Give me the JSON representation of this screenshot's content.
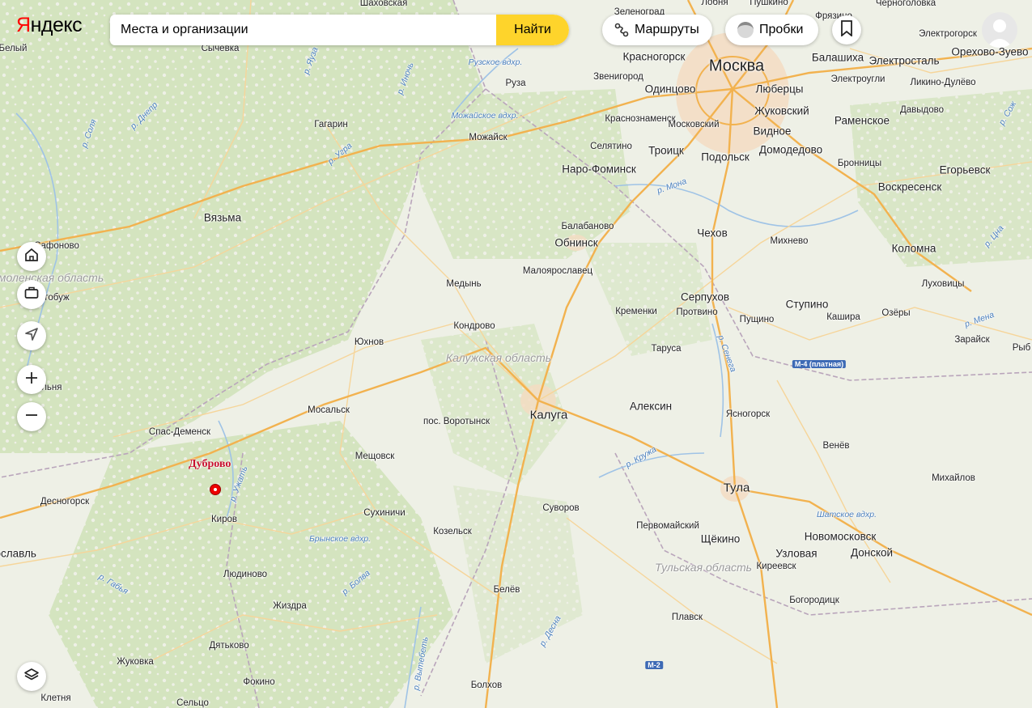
{
  "header": {
    "logo_first": "Я",
    "logo_rest": "ндекс",
    "search_placeholder": "Места и организации",
    "search_button": "Найти",
    "routes_label": "Маршруты",
    "traffic_label": "Пробки"
  },
  "marker": {
    "label": "Дуброво"
  },
  "map_labels": [
    {
      "text": "Москва",
      "kind": "cap"
    },
    {
      "text": "Калуга",
      "kind": "big"
    },
    {
      "text": "Тула",
      "kind": "big"
    },
    {
      "text": "Вязьма",
      "kind": "mid"
    },
    {
      "text": "Обнинск",
      "kind": "mid"
    },
    {
      "text": "Серпухов",
      "kind": "mid"
    },
    {
      "text": "Чехов",
      "kind": "mid"
    },
    {
      "text": "Подольск",
      "kind": "mid"
    },
    {
      "text": "Троицк",
      "kind": "mid"
    },
    {
      "text": "Одинцово",
      "kind": "mid"
    },
    {
      "text": "Красногорск",
      "kind": "mid"
    },
    {
      "text": "Люберцы",
      "kind": "mid"
    },
    {
      "text": "Жуковский",
      "kind": "mid"
    },
    {
      "text": "Раменское",
      "kind": "mid"
    },
    {
      "text": "Домодедово",
      "kind": "mid"
    },
    {
      "text": "Видное",
      "kind": "mid"
    },
    {
      "text": "Балашиха",
      "kind": "mid"
    },
    {
      "text": "Электросталь",
      "kind": "mid"
    },
    {
      "text": "Орехово-Зуево",
      "kind": "mid"
    },
    {
      "text": "Егорьевск",
      "kind": "mid"
    },
    {
      "text": "Воскресенск",
      "kind": "mid"
    },
    {
      "text": "Коломна",
      "kind": "mid"
    },
    {
      "text": "Ступино",
      "kind": "mid"
    },
    {
      "text": "Наро-Фоминск",
      "kind": "mid"
    },
    {
      "text": "Алексин",
      "kind": "mid"
    },
    {
      "text": "Щёкино",
      "kind": "mid"
    },
    {
      "text": "Новомосковск",
      "kind": "mid"
    },
    {
      "text": "Донской",
      "kind": "mid"
    },
    {
      "text": "Узловая",
      "kind": "mid"
    },
    {
      "text": "Зеленоград",
      "kind": "sm"
    },
    {
      "text": "Пушкино",
      "kind": "sm"
    },
    {
      "text": "Лобня",
      "kind": "sm"
    },
    {
      "text": "Фрязино",
      "kind": "sm"
    },
    {
      "text": "Шаховская",
      "kind": "sm"
    },
    {
      "text": "Белый",
      "kind": "sm"
    },
    {
      "text": "Сычевка",
      "kind": "sm"
    },
    {
      "text": "Руза",
      "kind": "sm"
    },
    {
      "text": "Звенигород",
      "kind": "sm"
    },
    {
      "text": "Краснознаменск",
      "kind": "sm"
    },
    {
      "text": "Московский",
      "kind": "sm"
    },
    {
      "text": "Селятино",
      "kind": "sm"
    },
    {
      "text": "Можайск",
      "kind": "sm"
    },
    {
      "text": "Гагарин",
      "kind": "sm"
    },
    {
      "text": "Электроугли",
      "kind": "sm"
    },
    {
      "text": "Ликино-Дулёво",
      "kind": "sm"
    },
    {
      "text": "Давыдово",
      "kind": "sm"
    },
    {
      "text": "Бронницы",
      "kind": "sm"
    },
    {
      "text": "Электрогорск",
      "kind": "sm"
    },
    {
      "text": "Черноголовка",
      "kind": "sm"
    },
    {
      "text": "Балабаново",
      "kind": "sm"
    },
    {
      "text": "Малоярославец",
      "kind": "sm"
    },
    {
      "text": "Медынь",
      "kind": "sm"
    },
    {
      "text": "Кондрово",
      "kind": "sm"
    },
    {
      "text": "Кременки",
      "kind": "sm"
    },
    {
      "text": "Протвино",
      "kind": "sm"
    },
    {
      "text": "Пущино",
      "kind": "sm"
    },
    {
      "text": "Таруса",
      "kind": "sm"
    },
    {
      "text": "Михнево",
      "kind": "sm"
    },
    {
      "text": "Кашира",
      "kind": "sm"
    },
    {
      "text": "Озёры",
      "kind": "sm"
    },
    {
      "text": "Луховицы",
      "kind": "sm"
    },
    {
      "text": "Зарайск",
      "kind": "sm"
    },
    {
      "text": "Рыб",
      "kind": "sm"
    },
    {
      "text": "Юхнов",
      "kind": "sm"
    },
    {
      "text": "Сафоново",
      "kind": "sm"
    },
    {
      "text": "Дорогобуж",
      "kind": "sm"
    },
    {
      "text": "Ельня",
      "kind": "sm"
    },
    {
      "text": "Спас-Деменск",
      "kind": "sm"
    },
    {
      "text": "Мосальск",
      "kind": "sm"
    },
    {
      "text": "пос. Воротынск",
      "kind": "sm"
    },
    {
      "text": "Мещовск",
      "kind": "sm"
    },
    {
      "text": "Ясногорск",
      "kind": "sm"
    },
    {
      "text": "Венёв",
      "kind": "sm"
    },
    {
      "text": "Михайлов",
      "kind": "sm"
    },
    {
      "text": "Десногорск",
      "kind": "sm"
    },
    {
      "text": "Киров",
      "kind": "sm"
    },
    {
      "text": "Сухиничи",
      "kind": "sm"
    },
    {
      "text": "Суворов",
      "kind": "sm"
    },
    {
      "text": "Козельск",
      "kind": "sm"
    },
    {
      "text": "Первомайский",
      "kind": "sm"
    },
    {
      "text": "Киреевск",
      "kind": "sm"
    },
    {
      "text": "Богородицк",
      "kind": "sm"
    },
    {
      "text": "Людиново",
      "kind": "sm"
    },
    {
      "text": "Жиздра",
      "kind": "sm"
    },
    {
      "text": "Белёв",
      "kind": "sm"
    },
    {
      "text": "Плавск",
      "kind": "sm"
    },
    {
      "text": "Дятьково",
      "kind": "sm"
    },
    {
      "text": "Жуковка",
      "kind": "sm"
    },
    {
      "text": "Фокино",
      "kind": "sm"
    },
    {
      "text": "Болхов",
      "kind": "sm"
    },
    {
      "text": "Клетня",
      "kind": "sm"
    },
    {
      "text": "Сельцо",
      "kind": "sm"
    },
    {
      "text": "Рославль",
      "kind": "mid"
    },
    {
      "text": "Калужская область",
      "kind": "region"
    },
    {
      "text": "Тульская область",
      "kind": "region"
    },
    {
      "text": "Смоленская область",
      "kind": "region"
    },
    {
      "text": "Рузское вдхр.",
      "kind": "water"
    },
    {
      "text": "Можайское вдхр.",
      "kind": "water"
    },
    {
      "text": "Шатское вдхр.",
      "kind": "water"
    },
    {
      "text": "Брынское вдхр.",
      "kind": "water"
    },
    {
      "text": "р. Иночь",
      "kind": "river"
    },
    {
      "text": "р. Яуза",
      "kind": "river"
    },
    {
      "text": "р. Днепр",
      "kind": "river"
    },
    {
      "text": "р. Сож",
      "kind": "river"
    },
    {
      "text": "р. Соля",
      "kind": "river"
    },
    {
      "text": "р. Угра",
      "kind": "river"
    },
    {
      "text": "р. Ужать",
      "kind": "river"
    },
    {
      "text": "р. Болва",
      "kind": "river"
    },
    {
      "text": "р. Десна",
      "kind": "river"
    },
    {
      "text": "р. Габья",
      "kind": "river"
    },
    {
      "text": "р. Вытебеть",
      "kind": "river"
    },
    {
      "text": "р. Мона",
      "kind": "river"
    },
    {
      "text": "р. Мена",
      "kind": "river"
    },
    {
      "text": "р. Сенега",
      "kind": "river"
    },
    {
      "text": "р. Цна",
      "kind": "river"
    },
    {
      "text": "р. Кружа",
      "kind": "river"
    },
    {
      "text": "М-4 (платная)",
      "kind": "hw"
    },
    {
      "text": "М-2",
      "kind": "hw"
    }
  ],
  "colors": {
    "background": "#eef0e6",
    "forest": "#cfe0b9",
    "road_major": "#f2b24f",
    "road_minor": "#f6d59a",
    "city_area": "#f3dcc2",
    "water": "#a9ccea",
    "border": "#b7a7b7",
    "search_button": "#fed42b",
    "marker": "#e00000",
    "marker_label": "#c8102e"
  }
}
